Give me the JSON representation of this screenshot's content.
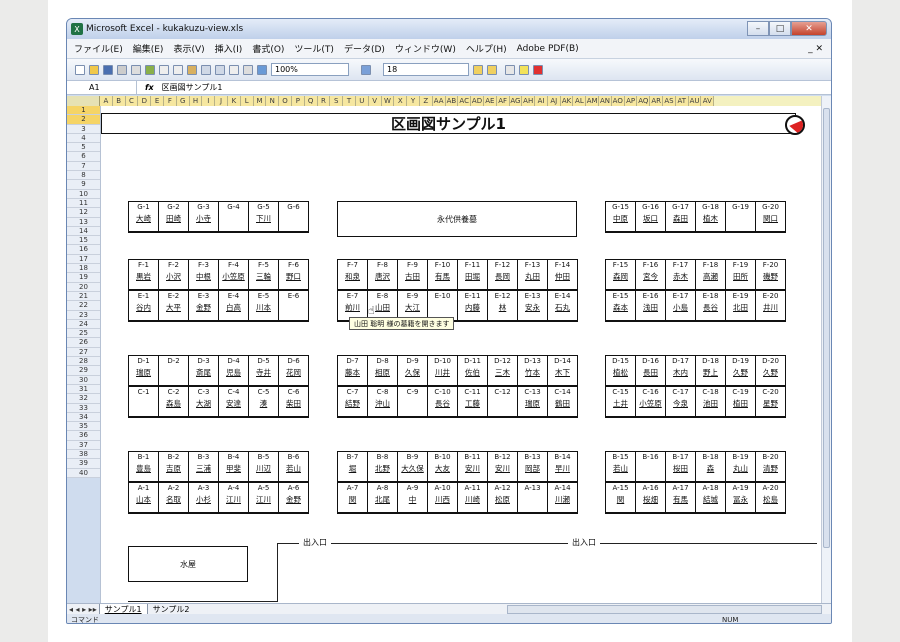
{
  "window": {
    "title": "Microsoft Excel - kukakuzu-view.xls",
    "btn_min": "–",
    "btn_max": "□",
    "btn_close": "✕"
  },
  "menu": [
    "ファイル(E)",
    "編集(E)",
    "表示(V)",
    "挿入(I)",
    "書式(O)",
    "ツール(T)",
    "データ(D)",
    "ウィンドウ(W)",
    "ヘルプ(H)",
    "Adobe PDF(B)"
  ],
  "menu_docctl": "_ ✕",
  "toolbar": {
    "zoom": "100%",
    "font_size": "18"
  },
  "formula": {
    "cellref": "A1",
    "fx": "fx",
    "content": "区画図サンプル1"
  },
  "columns": [
    "A",
    "B",
    "C",
    "D",
    "E",
    "F",
    "G",
    "H",
    "I",
    "J",
    "K",
    "L",
    "M",
    "N",
    "O",
    "P",
    "Q",
    "R",
    "S",
    "T",
    "U",
    "V",
    "W",
    "X",
    "Y",
    "Z",
    "AA",
    "AB",
    "AC",
    "AD",
    "AE",
    "AF",
    "AG",
    "AH",
    "AI",
    "AJ",
    "AK",
    "AL",
    "AM",
    "AN",
    "AO",
    "AP",
    "AQ",
    "AR",
    "AS",
    "AT",
    "AU",
    "AV"
  ],
  "rows": [
    "1",
    "2",
    "3",
    "4",
    "5",
    "6",
    "7",
    "8",
    "9",
    "10",
    "11",
    "12",
    "13",
    "14",
    "15",
    "16",
    "17",
    "18",
    "19",
    "20",
    "21",
    "22",
    "23",
    "24",
    "25",
    "26",
    "27",
    "28",
    "29",
    "30",
    "31",
    "32",
    "33",
    "34",
    "35",
    "36",
    "37",
    "38",
    "39",
    "40"
  ],
  "sheet_title": "区画図サンプル1",
  "eitai": "永代供養墓",
  "mizuya": "水屋",
  "exit_label": "出入口",
  "tooltip": "山田 聡明 様の墓籍を開きます",
  "blocks": {
    "G_left": [
      [
        "G-1",
        "大崎"
      ],
      [
        "G-2",
        "田崎"
      ],
      [
        "G-3",
        "小寺"
      ],
      [
        "G-4",
        ""
      ],
      [
        "G-5",
        "下川"
      ],
      [
        "G-6",
        ""
      ]
    ],
    "G_right": [
      [
        "G-15",
        "中原"
      ],
      [
        "G-16",
        "坂口"
      ],
      [
        "G-17",
        "森田"
      ],
      [
        "G-18",
        "植木"
      ],
      [
        "G-19",
        ""
      ],
      [
        "G-20",
        "関口"
      ]
    ],
    "F_left": [
      [
        "F-1",
        "黒岩"
      ],
      [
        "F-2",
        "小沢"
      ],
      [
        "F-3",
        "中根"
      ],
      [
        "F-4",
        "小笠原"
      ],
      [
        "F-5",
        "三輪"
      ],
      [
        "F-6",
        "野口"
      ]
    ],
    "E_left": [
      [
        "E-1",
        "谷内"
      ],
      [
        "E-2",
        "大平"
      ],
      [
        "E-3",
        "金野"
      ],
      [
        "E-4",
        "白高"
      ],
      [
        "E-5",
        "川本"
      ],
      [
        "E-6",
        ""
      ]
    ],
    "F_mid": [
      [
        "F-7",
        "和泉"
      ],
      [
        "F-8",
        "唐沢"
      ],
      [
        "F-9",
        "古田"
      ],
      [
        "F-10",
        "有馬"
      ],
      [
        "F-11",
        "田堀"
      ],
      [
        "F-12",
        "長岡"
      ],
      [
        "F-13",
        "丸田"
      ],
      [
        "F-14",
        "仲田"
      ]
    ],
    "E_mid": [
      [
        "E-7",
        "前川"
      ],
      [
        "E-8",
        "山田"
      ],
      [
        "E-9",
        "大江"
      ],
      [
        "E-10",
        ""
      ],
      [
        "E-11",
        "内藤"
      ],
      [
        "E-12",
        "林"
      ],
      [
        "E-13",
        "安永"
      ],
      [
        "E-14",
        "石丸"
      ]
    ],
    "F_right": [
      [
        "F-15",
        "森岡"
      ],
      [
        "F-16",
        "宮今"
      ],
      [
        "F-17",
        "赤木"
      ],
      [
        "F-18",
        "高瀬"
      ],
      [
        "F-19",
        "田所"
      ],
      [
        "F-20",
        "磯野"
      ]
    ],
    "E_right": [
      [
        "E-15",
        "森本"
      ],
      [
        "E-16",
        "浅田"
      ],
      [
        "E-17",
        "小島"
      ],
      [
        "E-18",
        "長谷"
      ],
      [
        "E-19",
        "北田"
      ],
      [
        "E-20",
        "井川"
      ]
    ],
    "D_left": [
      [
        "D-1",
        "瑞原"
      ],
      [
        "D-2",
        ""
      ],
      [
        "D-3",
        "斎尾"
      ],
      [
        "D-4",
        "児島"
      ],
      [
        "D-5",
        "寺井"
      ],
      [
        "D-6",
        "花岡"
      ]
    ],
    "C_left": [
      [
        "C-1",
        ""
      ],
      [
        "C-2",
        "森島"
      ],
      [
        "C-3",
        "大湖"
      ],
      [
        "C-4",
        "安達"
      ],
      [
        "C-5",
        "湊"
      ],
      [
        "C-6",
        "柴田"
      ]
    ],
    "D_mid": [
      [
        "D-7",
        "藤本"
      ],
      [
        "D-8",
        "相原"
      ],
      [
        "D-9",
        "久保"
      ],
      [
        "D-10",
        "川井"
      ],
      [
        "D-11",
        "佐伯"
      ],
      [
        "D-12",
        "三木"
      ],
      [
        "D-13",
        "竹本"
      ],
      [
        "D-14",
        "木下"
      ]
    ],
    "C_mid": [
      [
        "C-7",
        "結野"
      ],
      [
        "C-8",
        "沖山"
      ],
      [
        "C-9",
        ""
      ],
      [
        "C-10",
        "長谷"
      ],
      [
        "C-11",
        "工藤"
      ],
      [
        "C-12",
        ""
      ],
      [
        "C-13",
        "瑞原"
      ],
      [
        "C-14",
        "鶴田"
      ]
    ],
    "D_right": [
      [
        "D-15",
        "植松"
      ],
      [
        "D-16",
        "長田"
      ],
      [
        "D-17",
        "木内"
      ],
      [
        "D-18",
        "野上"
      ],
      [
        "D-19",
        "久野"
      ],
      [
        "D-20",
        "久野"
      ]
    ],
    "C_right": [
      [
        "C-15",
        "土井"
      ],
      [
        "C-16",
        "小笠原"
      ],
      [
        "C-17",
        "今泉"
      ],
      [
        "C-18",
        "池田"
      ],
      [
        "C-19",
        "植田"
      ],
      [
        "C-20",
        "星野"
      ]
    ],
    "B_left": [
      [
        "B-1",
        "豊島"
      ],
      [
        "B-2",
        "吉原"
      ],
      [
        "B-3",
        "三浦"
      ],
      [
        "B-4",
        "甲斐"
      ],
      [
        "B-5",
        "川辺"
      ],
      [
        "B-6",
        "若山"
      ]
    ],
    "A_left": [
      [
        "A-1",
        "山本"
      ],
      [
        "A-2",
        "名取"
      ],
      [
        "A-3",
        "小杉"
      ],
      [
        "A-4",
        "江川"
      ],
      [
        "A-5",
        "江川"
      ],
      [
        "A-6",
        "金野"
      ]
    ],
    "B_mid": [
      [
        "B-7",
        "堀"
      ],
      [
        "B-8",
        "北野"
      ],
      [
        "B-9",
        "大久保"
      ],
      [
        "B-10",
        "大友"
      ],
      [
        "B-11",
        "安川"
      ],
      [
        "B-12",
        "安川"
      ],
      [
        "B-13",
        "岡部"
      ],
      [
        "B-14",
        "早川"
      ]
    ],
    "A_mid": [
      [
        "A-7",
        "関"
      ],
      [
        "A-8",
        "北尾"
      ],
      [
        "A-9",
        "中"
      ],
      [
        "A-10",
        "川西"
      ],
      [
        "A-11",
        "川崎"
      ],
      [
        "A-12",
        "松原"
      ],
      [
        "A-13",
        ""
      ],
      [
        "A-14",
        "川瀬"
      ]
    ],
    "B_right": [
      [
        "B-15",
        "若山"
      ],
      [
        "B-16",
        ""
      ],
      [
        "B-17",
        "桜田"
      ],
      [
        "B-18",
        "森"
      ],
      [
        "B-19",
        "丸山"
      ],
      [
        "B-20",
        "清野"
      ]
    ],
    "A_right": [
      [
        "A-15",
        "関"
      ],
      [
        "A-16",
        "桜畑"
      ],
      [
        "A-17",
        "有馬"
      ],
      [
        "A-18",
        "結城"
      ],
      [
        "A-19",
        "冨永"
      ],
      [
        "A-20",
        "松島"
      ]
    ]
  },
  "sheets": {
    "tab1": "サンプル1",
    "tab2": "サンプル2",
    "nav": "◂ ◂ ▸ ▸▸"
  },
  "status": {
    "mode": "コマンド",
    "num": "NUM"
  }
}
